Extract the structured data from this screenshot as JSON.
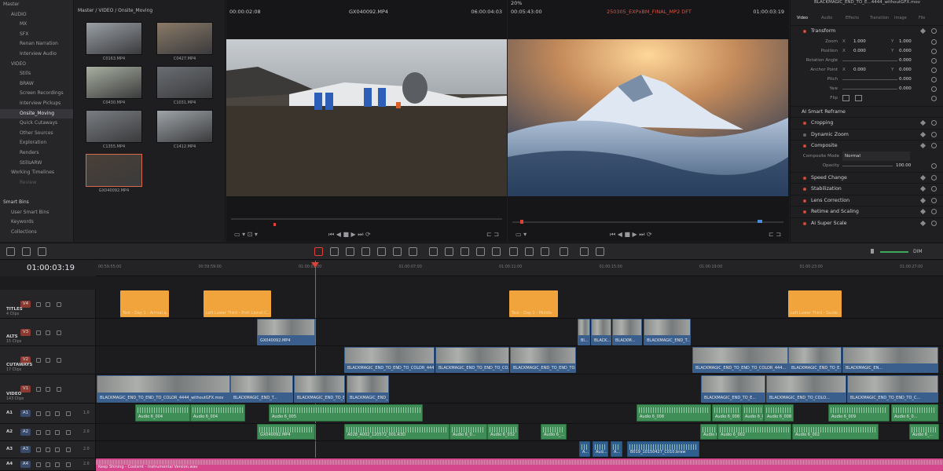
{
  "bins": {
    "items": [
      {
        "label": "Master",
        "level": "root"
      },
      {
        "label": "AUDIO",
        "level": "hdr"
      },
      {
        "label": "MX",
        "level": "l1"
      },
      {
        "label": "SFX",
        "level": "l1"
      },
      {
        "label": "Renan Narration",
        "level": "l1"
      },
      {
        "label": "Interview Audio",
        "level": "l1"
      },
      {
        "label": "VIDEO",
        "level": "hdr"
      },
      {
        "label": "Stills",
        "level": "l1"
      },
      {
        "label": "BRAW",
        "level": "l1"
      },
      {
        "label": "Screen Recordings",
        "level": "l1"
      },
      {
        "label": "Interview Pickups",
        "level": "l1"
      },
      {
        "label": "Onsite_Moving",
        "level": "l1",
        "selected": true
      },
      {
        "label": "Quick Cutaways",
        "level": "l1"
      },
      {
        "label": "Other Sources",
        "level": "l1"
      },
      {
        "label": "Exploration",
        "level": "l1"
      },
      {
        "label": "Renders",
        "level": "l1"
      },
      {
        "label": "StillsARW",
        "level": "l1"
      },
      {
        "label": "Working Timelines",
        "level": "hdr"
      },
      {
        "label": "Review",
        "level": "l1",
        "dim": true
      }
    ],
    "smart_title": "Smart Bins",
    "smart_items": [
      "User Smart Bins",
      "Keywords",
      "Collections"
    ]
  },
  "pool": {
    "path": "Master / VIDEO / Onsite_Moving",
    "clips": [
      {
        "name": "C0163.MP4",
        "tone": "#9aa0a6"
      },
      {
        "name": "C0427.MP4",
        "tone": "#8a7a68"
      },
      {
        "name": "C0430.MP4",
        "tone": "#a8b0a0"
      },
      {
        "name": "C1031.MP4",
        "tone": "#6a6e72"
      },
      {
        "name": "C1355.MP4",
        "tone": "#7a7e82"
      },
      {
        "name": "C1412.MP4",
        "tone": "#9ea4a8"
      },
      {
        "name": "GX040092.MP4",
        "tone": "#4a4036",
        "selected": true
      }
    ]
  },
  "source": {
    "tc_left": "00:00:02:08",
    "clip": "GX040092.MP4",
    "tc_right": "06:00:04:03"
  },
  "program": {
    "zoom": "20%",
    "tc_left": "00:05:43:00",
    "timeline": "250305_EXPxBM_FINAL_MP2 DFT",
    "tc_right": "01:00:03:19"
  },
  "inspector": {
    "file": "BLACKMAGIC_END_TO_E...4444_withoutGFX.mov",
    "tabs": [
      "Video",
      "Audio",
      "Effects",
      "Transition",
      "Image",
      "File"
    ],
    "transform_title": "Transform",
    "params": [
      {
        "label": "Zoom",
        "x": "1.000",
        "y": "1.000"
      },
      {
        "label": "Position",
        "x": "0.000",
        "y": "0.000"
      },
      {
        "label": "Rotation Angle",
        "v": "0.000"
      },
      {
        "label": "Anchor Point",
        "x": "0.000",
        "y": "0.000"
      },
      {
        "label": "Pitch",
        "v": "0.000"
      },
      {
        "label": "Yaw",
        "v": "0.000"
      },
      {
        "label": "Flip"
      }
    ],
    "ai_reframe": "AI Smart Reframe",
    "sections": [
      "Cropping",
      "Dynamic Zoom",
      "Composite"
    ],
    "composite_mode_label": "Composite Mode",
    "composite_mode": "Normal",
    "opacity_label": "Opacity",
    "opacity": "100.00",
    "sections2": [
      "Speed Change",
      "Stabilization",
      "Lens Correction",
      "Retime and Scaling",
      "AI Super Scale"
    ]
  },
  "toolbar": {
    "dim": "DIM"
  },
  "timeline": {
    "timecode": "01:00:03:19",
    "ticks": [
      "00:59:55:00",
      "00:59:59:00",
      "01:00:03:00",
      "01:00:07:00",
      "01:00:11:00",
      "01:00:15:00",
      "01:00:19:00",
      "01:00:23:00",
      "01:00:27:00"
    ],
    "tracks": [
      {
        "id": "V4",
        "name": "TITLES",
        "count": "4 Clips"
      },
      {
        "id": "V3",
        "name": "ALTS",
        "count": "15 Clips"
      },
      {
        "id": "V2",
        "name": "CUTAWAYS",
        "count": "17 Clips"
      },
      {
        "id": "V1",
        "name": "VIDEO",
        "count": "143 Clips"
      },
      {
        "id": "A1",
        "vol": "1.0"
      },
      {
        "id": "A2",
        "vol": "2.0"
      },
      {
        "id": "A3",
        "vol": "2.0"
      },
      {
        "id": "A4",
        "vol": "2.0"
      }
    ],
    "v4": [
      "Text - Day 1 - Arrival a...",
      "Left Lower Third - Prof. Lionel C...",
      "Text - Day 2 - Middle",
      "Left Lower Third - Guide - Nayen..."
    ],
    "v3": [
      "GX040092.MP4",
      "Bl...",
      "BLACK...",
      "BLACKM...",
      "BLACKMAGIC_END_T..."
    ],
    "v2": [
      "BLACKMAGIC_END_TO_END_TO_COLOR_444...",
      "BLACKMAGIC_END_TO_END_TO_CO...",
      "BLACKMAGIC_END_TO_END_TO...",
      "BLACKMAGIC_END_TO_END_TO_COLOR_444...",
      "BLACKMAGIC_END_TO_E...",
      "BLACKMAGIC_EN..."
    ],
    "v1": [
      "BLACKMAGIC_END_TO_END_TO_COLOR_4444_withoutGFX.mov",
      "BLACKMAGIC_END_T...",
      "BLACKMAGIC_END_TO_E...",
      "BLACKMAGIC_END_TO_E...",
      "BLACKMAGIC_END_TO_E...",
      "BLACKMAGIC_END_TO_COLO...",
      "BLACKMAGIC_END_TO_END_TO_C..."
    ],
    "a1": [
      "Audio 6_004",
      "Audio 6_004",
      "Audio 6_005",
      "Audio 6_008",
      "Audio 6_008",
      "Audio 6_008",
      "Audio 6_008",
      "Audio 6_009",
      "Audio 6_0..."
    ],
    "a2": [
      "GX040092.MP4",
      "A028_A002_120572_001.R3D",
      "Audio 6_0...",
      "Audio 6_032",
      "Audio 6_...",
      "Audio 6_002",
      "Audio 6_002",
      "Audio 6_002",
      "Audio 6_..."
    ],
    "a3": [
      "A...",
      "Aud...",
      "A...",
      "B019_10150427_C010.braw"
    ],
    "a4": "Keep Shining - Coolsmt - Instrumental Version.wav"
  },
  "colors": {
    "accent": "#e0403a",
    "title": "#f0a43b",
    "video": "#3b5f8c",
    "audio": "#3f8d57",
    "music": "#d6488d"
  }
}
